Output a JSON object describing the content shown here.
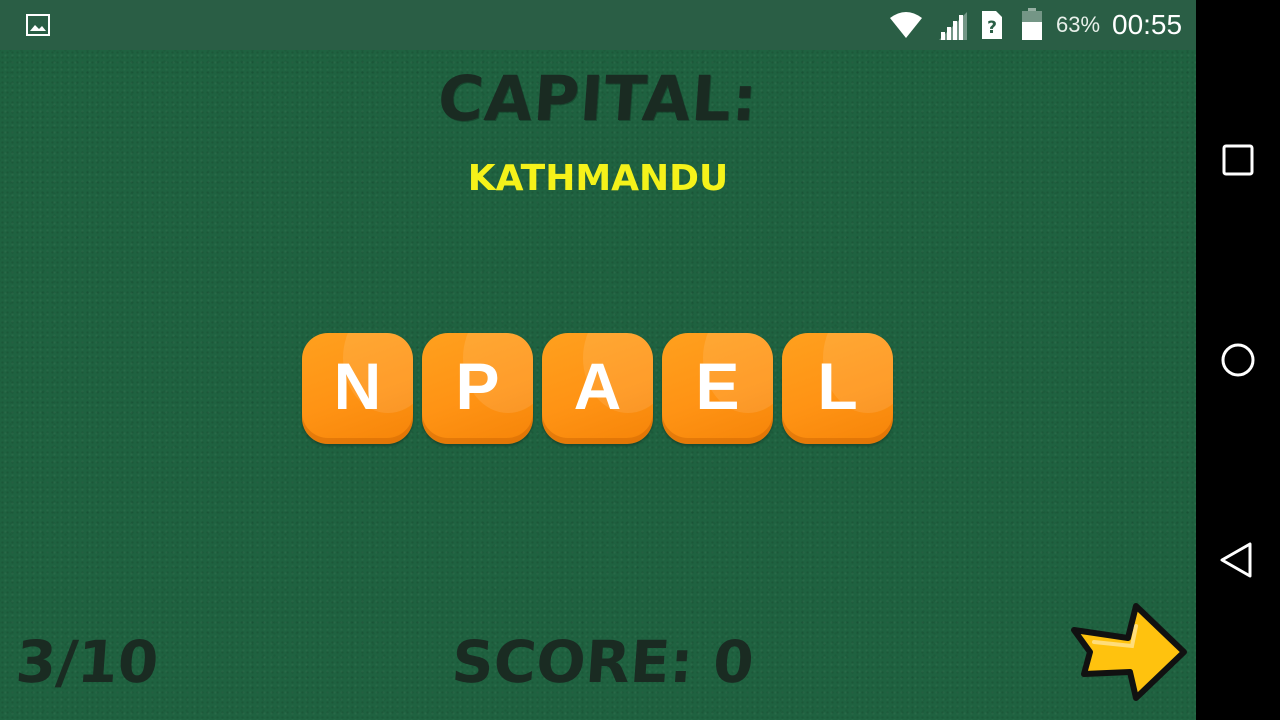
{
  "status_bar": {
    "battery_percent": "63%",
    "time": "00:55",
    "icons": [
      "gallery-icon",
      "wifi-icon",
      "signal-icon",
      "sim-icon",
      "battery-icon"
    ],
    "battery_level": 0.63
  },
  "game": {
    "category_title": "CAPITAL:",
    "hint": "KATHMANDU",
    "tiles": [
      "N",
      "P",
      "A",
      "E",
      "L"
    ],
    "progress": "3/10",
    "score": "SCORE: 0"
  },
  "nav_bar": {
    "icons": [
      "recents-icon",
      "home-icon",
      "back-icon"
    ]
  },
  "colors": {
    "background": "#1f6240",
    "status_bar": "#2a5e45",
    "tile": "#ff9314",
    "hint_text": "#f5f21a",
    "heading_text": "#1a2b22",
    "next_arrow": "#ffc20e"
  }
}
